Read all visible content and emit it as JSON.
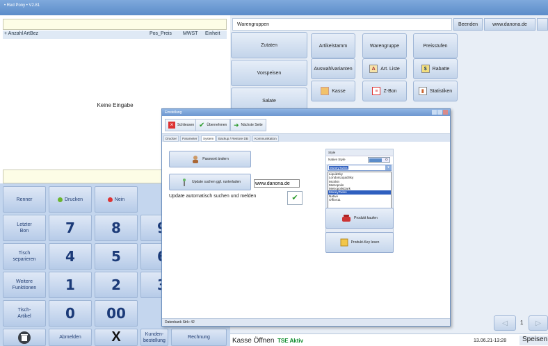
{
  "app": {
    "title": "• Red Pony • V2.81"
  },
  "order": {
    "columns": [
      "+ Anzahl",
      "ArtBez",
      "Pos_Preis",
      "MWST",
      "Einheit"
    ],
    "empty_message": "Keine Eingabe"
  },
  "keypad": {
    "renner": "Renner",
    "drucken": "Drucken",
    "nein": "Nein",
    "letzter_bon": "Letzter\nBon",
    "tisch_separieren": "Tisch\nseparieren",
    "weitere_funktionen": "Weitere\nFunktionen",
    "tisch_artikel": "Tisch-\nArtikel",
    "abmelden": "Abmelden",
    "x": "X",
    "kundenbestellung": "Kunden-\nbestellung",
    "rechnung": "Rechnung",
    "digits": [
      "7",
      "8",
      "9",
      "4",
      "5",
      "6",
      "1",
      "2",
      "3",
      "0",
      "00"
    ]
  },
  "right": {
    "warengruppen": "Warengruppen",
    "beenden": "Beenden",
    "website": "www.danona.de",
    "groups": [
      "Zutaten",
      "Vorspeisen",
      "Salate"
    ],
    "functions": {
      "artikelstamm": "Artikelstamm",
      "warengruppe": "Warengruppe",
      "preisstufen": "Preisstufen",
      "auswahlvarianten": "Auswahlvarianten",
      "art_liste": "Art. Liste",
      "rabatte": "Rabatte",
      "kasse": "Kasse",
      "z_bon": "Z-Bon",
      "statistiken": "Statistiken"
    },
    "page_number": "1"
  },
  "statusbar": {
    "kasse_oeffnen": "Kasse Öffnen",
    "tse": "TSE Aktiv",
    "datetime": "13.06.21-13:28",
    "speisen": "Speisen"
  },
  "dialog": {
    "title": "Einstellung",
    "toolbar": {
      "schliessen": "Schliessen",
      "uebernehmen": "Übernehmen",
      "naechste_seite": "Nächste Seite"
    },
    "tabs": [
      "Drucker",
      "Parameter",
      "System",
      "Backup / Restore DB",
      "Kommunikation"
    ],
    "passwort_button": "Passwort ändern",
    "update_button": "Update suchen ggf. runterladen",
    "update_url": "www.danona.de",
    "auto_update_label": "Update automatisch suchen und melden",
    "style": {
      "header": "Style",
      "native_label": "Native Style",
      "toggle_value": "O",
      "selected": "MoneyTwins",
      "options": [
        "LiquidSky",
        "LondonLiquidSky",
        "McSkin",
        "Metropolis",
        "MetropolisDark",
        "MoneyTwins",
        "Native",
        "Office11"
      ]
    },
    "produkt_kaufen": "Produkt kaufen",
    "produkt_key": "Produkt-Key lesen",
    "status": "Datenbank Strk: 42"
  },
  "colors": {
    "accent": "#5b8cc9",
    "keypad_bg": "#c4d6ee",
    "tse_green": "#0a8a2a"
  }
}
